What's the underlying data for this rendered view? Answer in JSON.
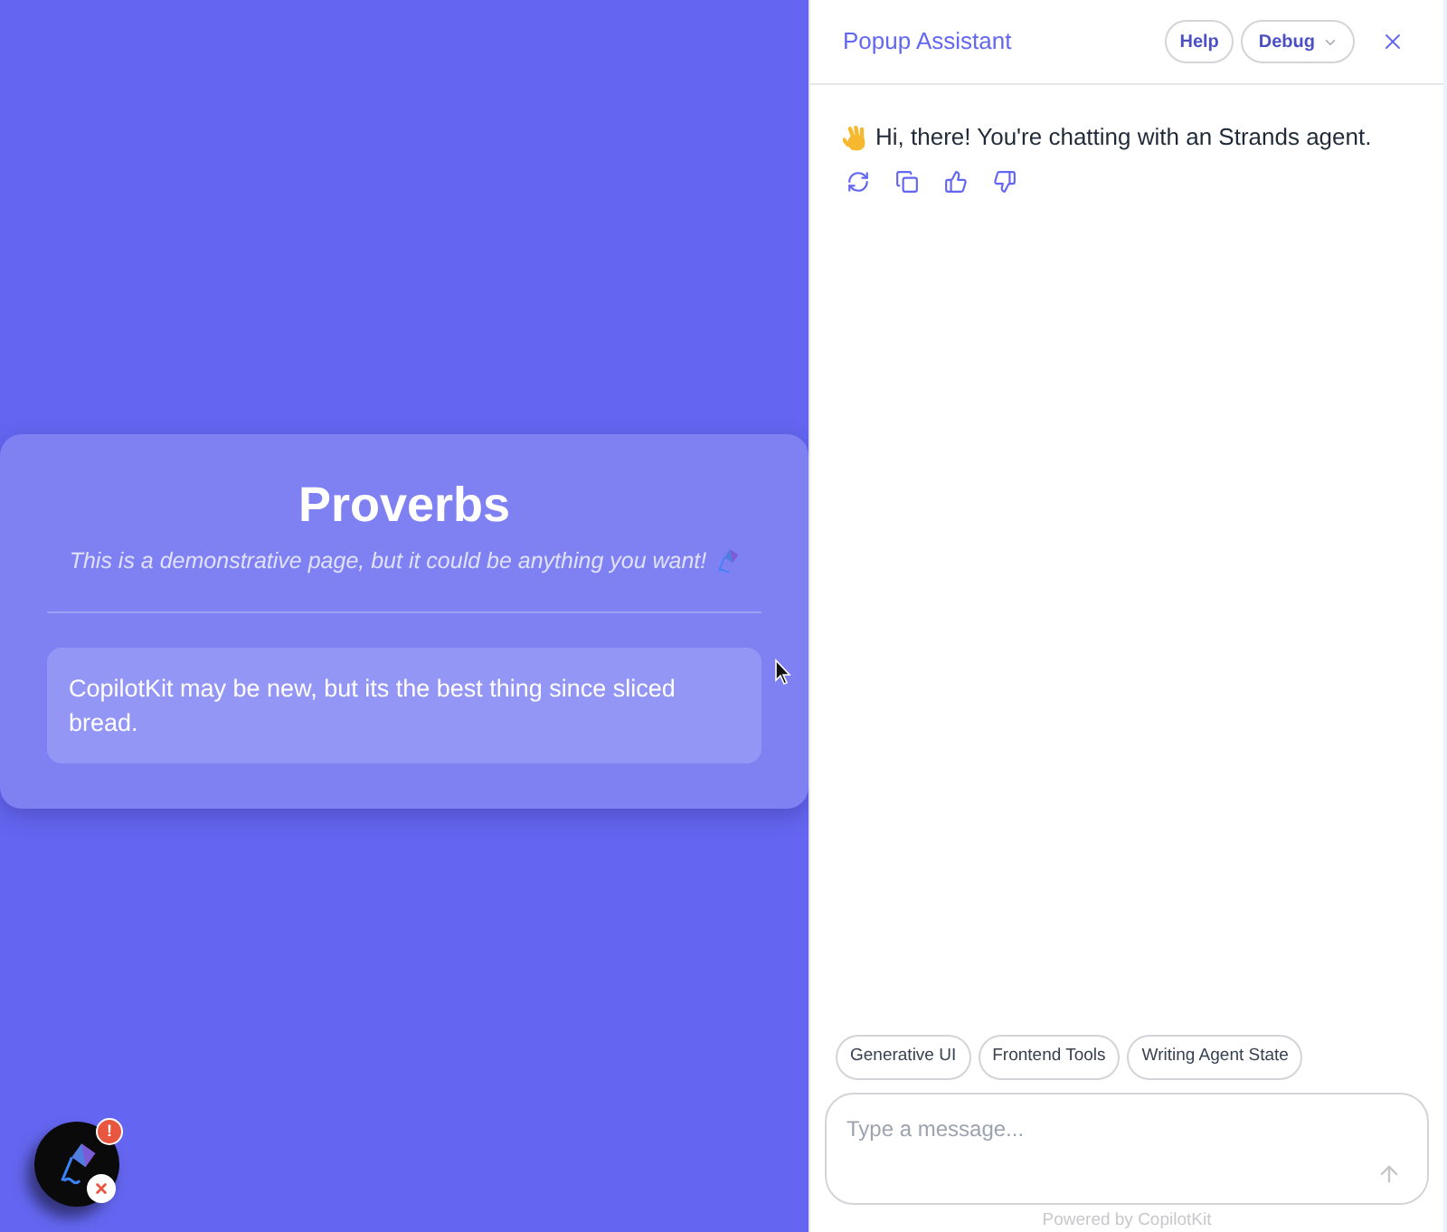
{
  "page": {
    "title": "Proverbs",
    "subtitle": "This is a demonstrative page, but it could be anything you want!",
    "proverbs": [
      "CopilotKit may be new, but its the best thing since sliced bread."
    ]
  },
  "launcher": {
    "badge": "!"
  },
  "chat": {
    "title": "Popup Assistant",
    "header_buttons": [
      {
        "label": "Help",
        "kind": "plain"
      },
      {
        "label": "Debug",
        "kind": "dropdown"
      }
    ],
    "messages": [
      {
        "text": "Hi, there! You're chatting with an Strands agent."
      }
    ],
    "suggestions": [
      "Generative UI",
      "Frontend Tools",
      "Writing Agent State"
    ],
    "input": {
      "placeholder": "Type a message..."
    },
    "footer": "Powered by CopilotKit"
  }
}
